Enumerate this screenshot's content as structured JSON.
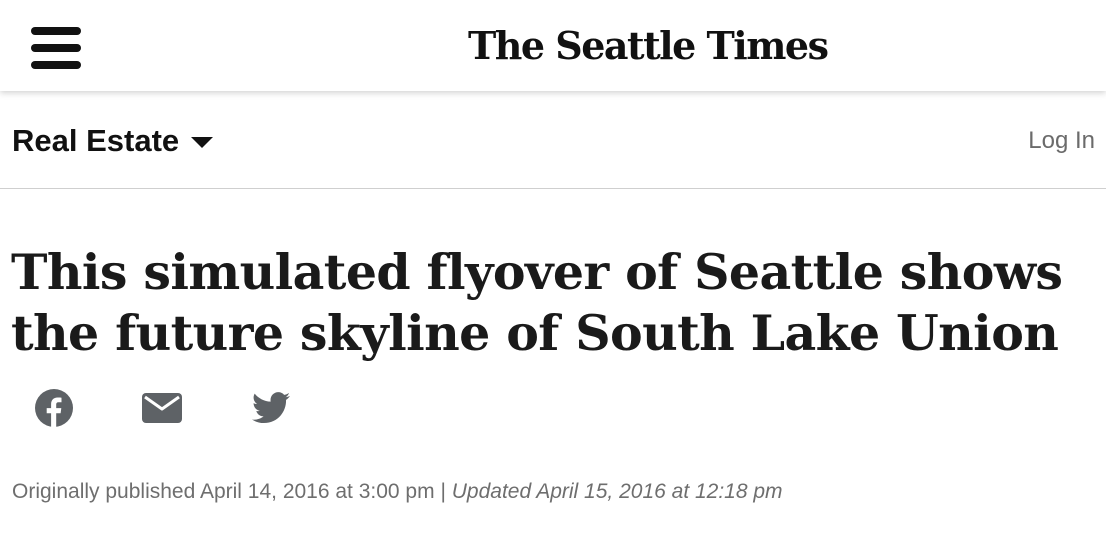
{
  "header": {
    "menu_icon": "hamburger-menu-icon",
    "masthead": "The Seattle Times"
  },
  "section_bar": {
    "section_label": "Real Estate",
    "dropdown_icon": "caret-down-icon",
    "login_label": "Log In"
  },
  "article": {
    "headline": "This simulated flyover of Seattle shows the future skyline of South Lake Union",
    "share_icons": [
      "facebook-icon",
      "email-icon",
      "twitter-icon"
    ],
    "published": "Originally published April 14, 2016 at 3:00 pm",
    "separator": "|",
    "updated": "Updated April 15, 2016 at 12:18 pm"
  },
  "colors": {
    "text": "#1a1a1a",
    "muted": "#6e6e6e",
    "share_icon": "#5e6266",
    "divider": "#cfcfcf"
  }
}
